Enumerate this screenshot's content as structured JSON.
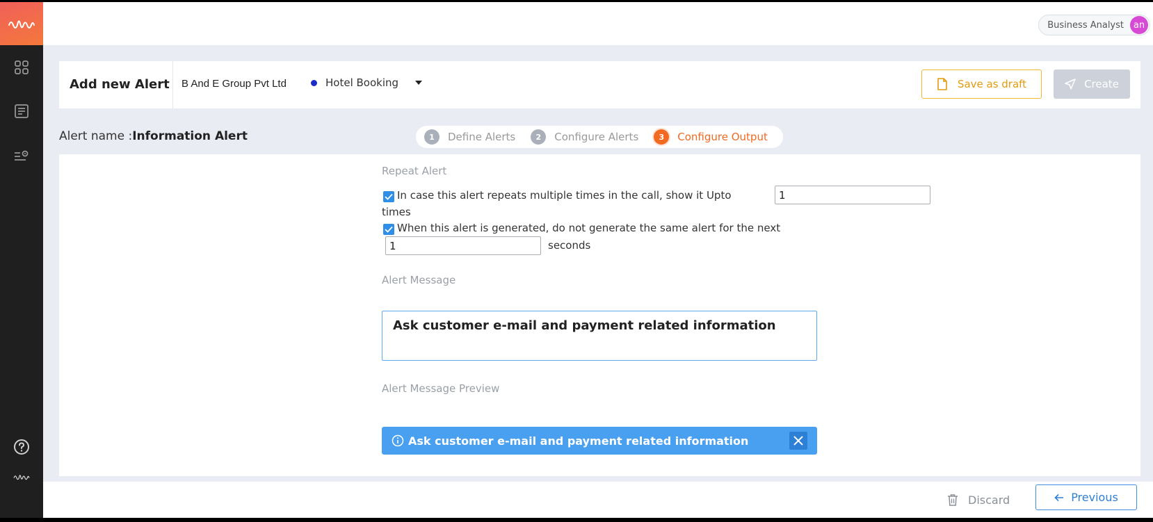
{
  "user": {
    "role": "Business Analyst",
    "initials": "an",
    "avatar_color": "#d849d6"
  },
  "sidebar": {
    "logo_icon": "waveform-logo-icon",
    "items": [
      {
        "icon": "dashboard-grid-icon"
      },
      {
        "icon": "document-list-icon"
      },
      {
        "icon": "settings-list-icon"
      }
    ],
    "bottom": [
      {
        "icon": "help-circle-icon"
      },
      {
        "icon": "waveform-logo-icon"
      }
    ]
  },
  "header": {
    "title": "Add new Alert",
    "company": "B And E Group Pvt Ltd",
    "project": "Hotel Booking",
    "project_dot_color": "#1a2dc9",
    "save_draft_label": "Save as draft",
    "create_label": "Create"
  },
  "alert": {
    "name_label": "Alert name :",
    "name_value": "Information Alert"
  },
  "stepper": {
    "steps": [
      {
        "num": "1",
        "label": "Define Alerts"
      },
      {
        "num": "2",
        "label": "Configure Alerts"
      },
      {
        "num": "3",
        "label": "Configure Output"
      }
    ],
    "active_color": "#f26a21"
  },
  "repeat": {
    "section_label": "Repeat Alert",
    "option1_text": "In case this alert repeats multiple times in the call, show it Upto",
    "option1_value": "1",
    "option1_suffix": "times",
    "option2_text": "When this alert is generated, do not generate the same alert for the next",
    "option2_value": "1",
    "option2_suffix": "seconds"
  },
  "message": {
    "section_label": "Alert Message",
    "value": "Ask customer e-mail and payment related information"
  },
  "preview": {
    "section_label": "Alert Message Preview",
    "text": "Ask customer e-mail and payment related information",
    "bg_color": "#4aa0f0"
  },
  "footer": {
    "discard_label": "Discard",
    "previous_label": "Previous"
  }
}
